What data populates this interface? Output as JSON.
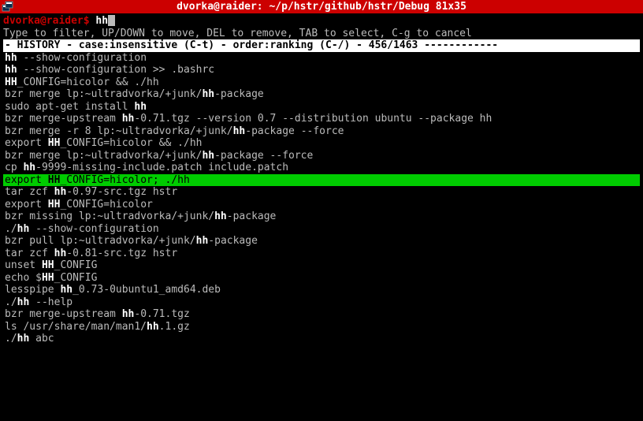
{
  "window": {
    "title": "dvorka@raider: ~/p/hstr/github/hstr/Debug 81x35"
  },
  "prompt": {
    "userhost": "dvorka@raider$ ",
    "typed": "hh"
  },
  "hint": "Type to filter, UP/DOWN to move, DEL to remove, TAB to select, C-g to cancel",
  "status": "- HISTORY - case:insensitive (C-t) - order:ranking (C-/) - 456/1463 ------------",
  "selected_index": 10,
  "history": [
    {
      "pre": "",
      "hl": "hh",
      "post": " --show-configuration"
    },
    {
      "pre": "",
      "hl": "hh",
      "post": " --show-configuration >> .bashrc"
    },
    {
      "pre": "",
      "hl": "HH",
      "post": "_CONFIG=hicolor && ./hh"
    },
    {
      "pre": "bzr merge lp:~ultradvorka/+junk/",
      "hl": "hh",
      "post": "-package"
    },
    {
      "pre": "sudo apt-get install ",
      "hl": "hh",
      "post": ""
    },
    {
      "pre": "bzr merge-upstream ",
      "hl": "hh",
      "post": "-0.71.tgz --version 0.7 --distribution ubuntu --package hh"
    },
    {
      "pre": "bzr merge -r 8 lp:~ultradvorka/+junk/",
      "hl": "hh",
      "post": "-package --force"
    },
    {
      "pre": "export ",
      "hl": "HH",
      "post": "_CONFIG=hicolor && ./hh"
    },
    {
      "pre": "bzr merge lp:~ultradvorka/+junk/",
      "hl": "hh",
      "post": "-package --force"
    },
    {
      "pre": "cp ",
      "hl": "hh",
      "post": "-9999-missing-include.patch include.patch"
    },
    {
      "pre": "export ",
      "hl": "HH",
      "post": "_CONFIG=hicolor; ./hh"
    },
    {
      "pre": "tar zcf ",
      "hl": "hh",
      "post": "-0.97-src.tgz hstr"
    },
    {
      "pre": "export ",
      "hl": "HH",
      "post": "_CONFIG=hicolor"
    },
    {
      "pre": "bzr missing lp:~ultradvorka/+junk/",
      "hl": "hh",
      "post": "-package"
    },
    {
      "pre": "./",
      "hl": "hh",
      "post": " --show-configuration"
    },
    {
      "pre": "bzr pull lp:~ultradvorka/+junk/",
      "hl": "hh",
      "post": "-package"
    },
    {
      "pre": "tar zcf ",
      "hl": "hh",
      "post": "-0.81-src.tgz hstr"
    },
    {
      "pre": "unset ",
      "hl": "HH",
      "post": "_CONFIG"
    },
    {
      "pre": "echo $",
      "hl": "HH",
      "post": "_CONFIG"
    },
    {
      "pre": "lesspipe ",
      "hl": "hh",
      "post": "_0.73-0ubuntu1_amd64.deb"
    },
    {
      "pre": "./",
      "hl": "hh",
      "post": " --help"
    },
    {
      "pre": "bzr merge-upstream ",
      "hl": "hh",
      "post": "-0.71.tgz"
    },
    {
      "pre": "ls /usr/share/man/man1/",
      "hl": "hh",
      "post": ".1.gz"
    },
    {
      "pre": "./",
      "hl": "hh",
      "post": " abc"
    }
  ]
}
